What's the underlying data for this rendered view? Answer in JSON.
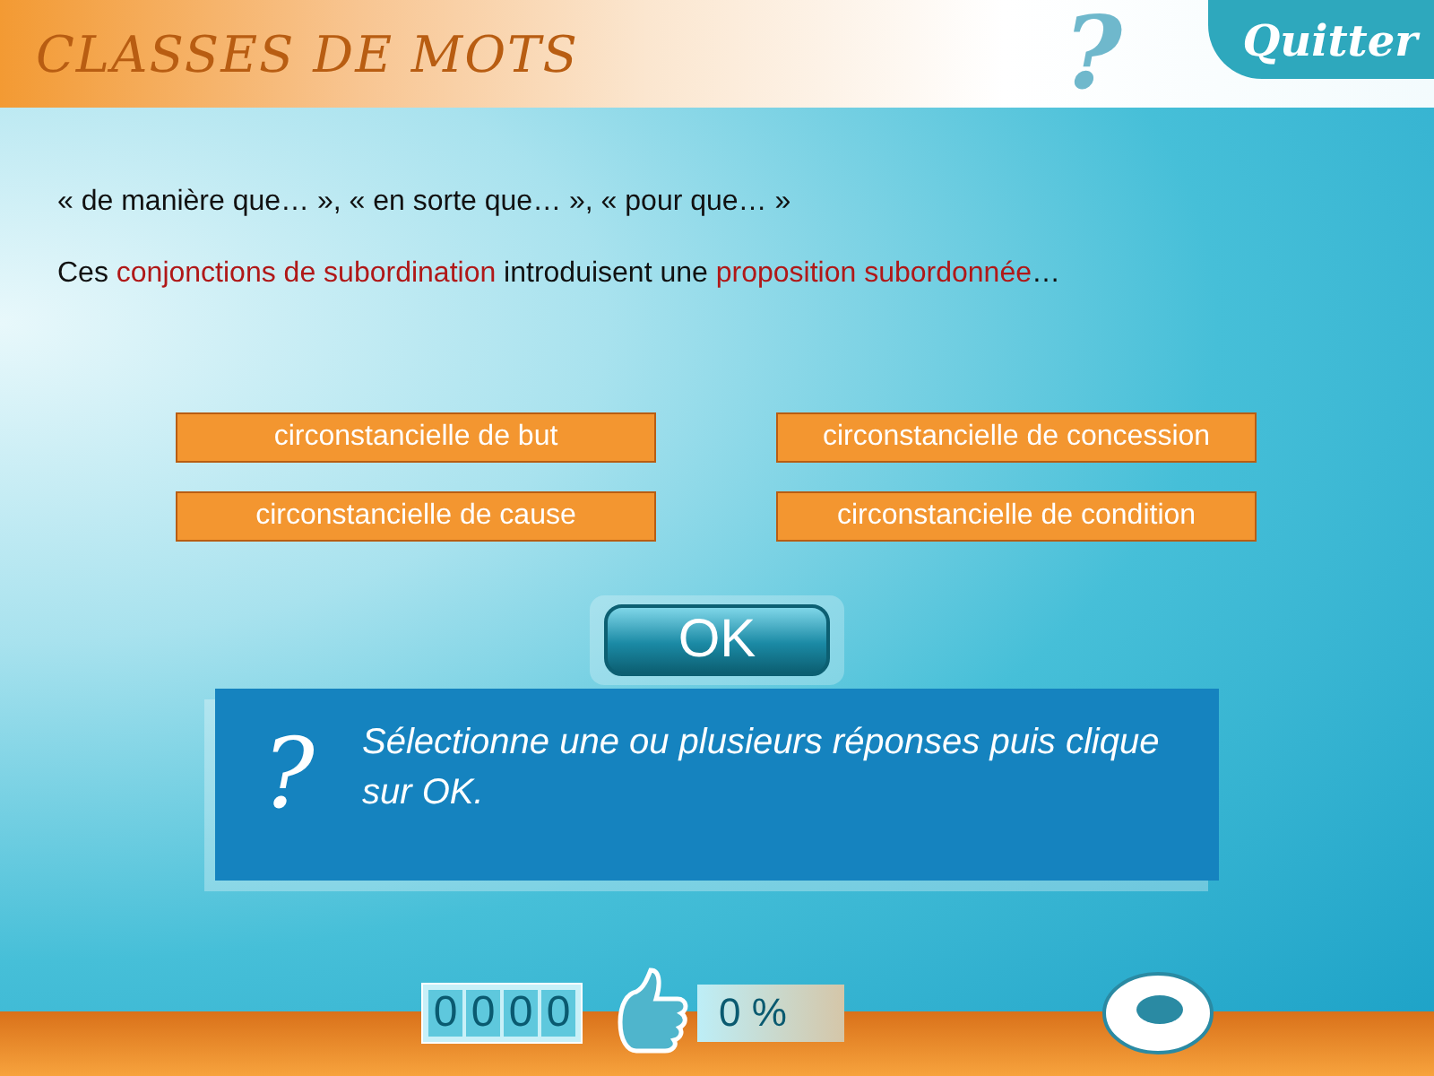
{
  "header": {
    "title": "CLASSES DE MOTS",
    "help": "?",
    "quit": "Quitter"
  },
  "examples": "« de manière que… », « en sorte que… », « pour que… »",
  "sentence": [
    {
      "text": "Ces ",
      "highlight": false
    },
    {
      "text": "conjonctions de subordination",
      "highlight": true
    },
    {
      "text": " introduisent une ",
      "highlight": false
    },
    {
      "text": "proposition subordonnée",
      "highlight": true
    },
    {
      "text": "…",
      "highlight": false
    }
  ],
  "answers": [
    {
      "label": "circonstancielle de but",
      "selected": false
    },
    {
      "label": "circonstancielle de concession",
      "selected": false
    },
    {
      "label": "circonstancielle de cause",
      "selected": false
    },
    {
      "label": "circonstancielle de condition",
      "selected": false
    }
  ],
  "ok": "OK",
  "message": {
    "icon": "?",
    "text": "Sélectionne une ou plusieurs réponses puis clique sur OK."
  },
  "footer": {
    "score": [
      "0",
      "0",
      "0",
      "0"
    ],
    "percent": "0 %"
  }
}
